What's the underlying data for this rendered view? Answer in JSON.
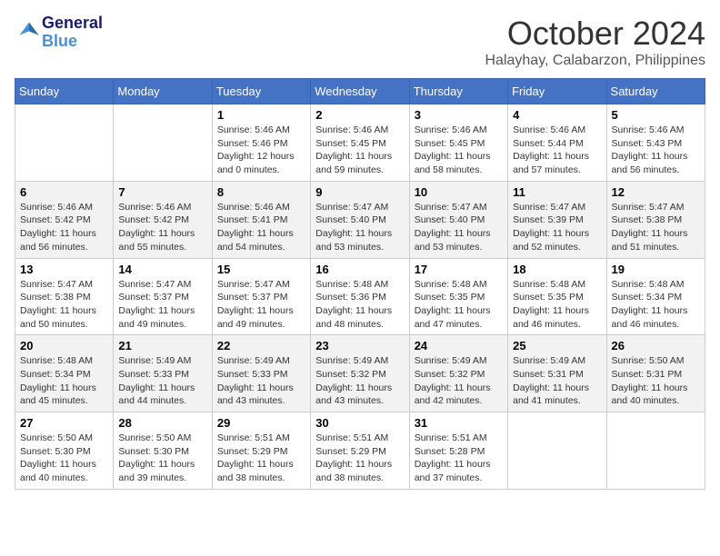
{
  "logo": {
    "line1": "General",
    "line2": "Blue"
  },
  "title": "October 2024",
  "location": "Halayhay, Calabarzon, Philippines",
  "days_header": [
    "Sunday",
    "Monday",
    "Tuesday",
    "Wednesday",
    "Thursday",
    "Friday",
    "Saturday"
  ],
  "weeks": [
    [
      {
        "num": "",
        "info": ""
      },
      {
        "num": "",
        "info": ""
      },
      {
        "num": "1",
        "info": "Sunrise: 5:46 AM\nSunset: 5:46 PM\nDaylight: 12 hours\nand 0 minutes."
      },
      {
        "num": "2",
        "info": "Sunrise: 5:46 AM\nSunset: 5:45 PM\nDaylight: 11 hours\nand 59 minutes."
      },
      {
        "num": "3",
        "info": "Sunrise: 5:46 AM\nSunset: 5:45 PM\nDaylight: 11 hours\nand 58 minutes."
      },
      {
        "num": "4",
        "info": "Sunrise: 5:46 AM\nSunset: 5:44 PM\nDaylight: 11 hours\nand 57 minutes."
      },
      {
        "num": "5",
        "info": "Sunrise: 5:46 AM\nSunset: 5:43 PM\nDaylight: 11 hours\nand 56 minutes."
      }
    ],
    [
      {
        "num": "6",
        "info": "Sunrise: 5:46 AM\nSunset: 5:42 PM\nDaylight: 11 hours\nand 56 minutes."
      },
      {
        "num": "7",
        "info": "Sunrise: 5:46 AM\nSunset: 5:42 PM\nDaylight: 11 hours\nand 55 minutes."
      },
      {
        "num": "8",
        "info": "Sunrise: 5:46 AM\nSunset: 5:41 PM\nDaylight: 11 hours\nand 54 minutes."
      },
      {
        "num": "9",
        "info": "Sunrise: 5:47 AM\nSunset: 5:40 PM\nDaylight: 11 hours\nand 53 minutes."
      },
      {
        "num": "10",
        "info": "Sunrise: 5:47 AM\nSunset: 5:40 PM\nDaylight: 11 hours\nand 53 minutes."
      },
      {
        "num": "11",
        "info": "Sunrise: 5:47 AM\nSunset: 5:39 PM\nDaylight: 11 hours\nand 52 minutes."
      },
      {
        "num": "12",
        "info": "Sunrise: 5:47 AM\nSunset: 5:38 PM\nDaylight: 11 hours\nand 51 minutes."
      }
    ],
    [
      {
        "num": "13",
        "info": "Sunrise: 5:47 AM\nSunset: 5:38 PM\nDaylight: 11 hours\nand 50 minutes."
      },
      {
        "num": "14",
        "info": "Sunrise: 5:47 AM\nSunset: 5:37 PM\nDaylight: 11 hours\nand 49 minutes."
      },
      {
        "num": "15",
        "info": "Sunrise: 5:47 AM\nSunset: 5:37 PM\nDaylight: 11 hours\nand 49 minutes."
      },
      {
        "num": "16",
        "info": "Sunrise: 5:48 AM\nSunset: 5:36 PM\nDaylight: 11 hours\nand 48 minutes."
      },
      {
        "num": "17",
        "info": "Sunrise: 5:48 AM\nSunset: 5:35 PM\nDaylight: 11 hours\nand 47 minutes."
      },
      {
        "num": "18",
        "info": "Sunrise: 5:48 AM\nSunset: 5:35 PM\nDaylight: 11 hours\nand 46 minutes."
      },
      {
        "num": "19",
        "info": "Sunrise: 5:48 AM\nSunset: 5:34 PM\nDaylight: 11 hours\nand 46 minutes."
      }
    ],
    [
      {
        "num": "20",
        "info": "Sunrise: 5:48 AM\nSunset: 5:34 PM\nDaylight: 11 hours\nand 45 minutes."
      },
      {
        "num": "21",
        "info": "Sunrise: 5:49 AM\nSunset: 5:33 PM\nDaylight: 11 hours\nand 44 minutes."
      },
      {
        "num": "22",
        "info": "Sunrise: 5:49 AM\nSunset: 5:33 PM\nDaylight: 11 hours\nand 43 minutes."
      },
      {
        "num": "23",
        "info": "Sunrise: 5:49 AM\nSunset: 5:32 PM\nDaylight: 11 hours\nand 43 minutes."
      },
      {
        "num": "24",
        "info": "Sunrise: 5:49 AM\nSunset: 5:32 PM\nDaylight: 11 hours\nand 42 minutes."
      },
      {
        "num": "25",
        "info": "Sunrise: 5:49 AM\nSunset: 5:31 PM\nDaylight: 11 hours\nand 41 minutes."
      },
      {
        "num": "26",
        "info": "Sunrise: 5:50 AM\nSunset: 5:31 PM\nDaylight: 11 hours\nand 40 minutes."
      }
    ],
    [
      {
        "num": "27",
        "info": "Sunrise: 5:50 AM\nSunset: 5:30 PM\nDaylight: 11 hours\nand 40 minutes."
      },
      {
        "num": "28",
        "info": "Sunrise: 5:50 AM\nSunset: 5:30 PM\nDaylight: 11 hours\nand 39 minutes."
      },
      {
        "num": "29",
        "info": "Sunrise: 5:51 AM\nSunset: 5:29 PM\nDaylight: 11 hours\nand 38 minutes."
      },
      {
        "num": "30",
        "info": "Sunrise: 5:51 AM\nSunset: 5:29 PM\nDaylight: 11 hours\nand 38 minutes."
      },
      {
        "num": "31",
        "info": "Sunrise: 5:51 AM\nSunset: 5:28 PM\nDaylight: 11 hours\nand 37 minutes."
      },
      {
        "num": "",
        "info": ""
      },
      {
        "num": "",
        "info": ""
      }
    ]
  ]
}
